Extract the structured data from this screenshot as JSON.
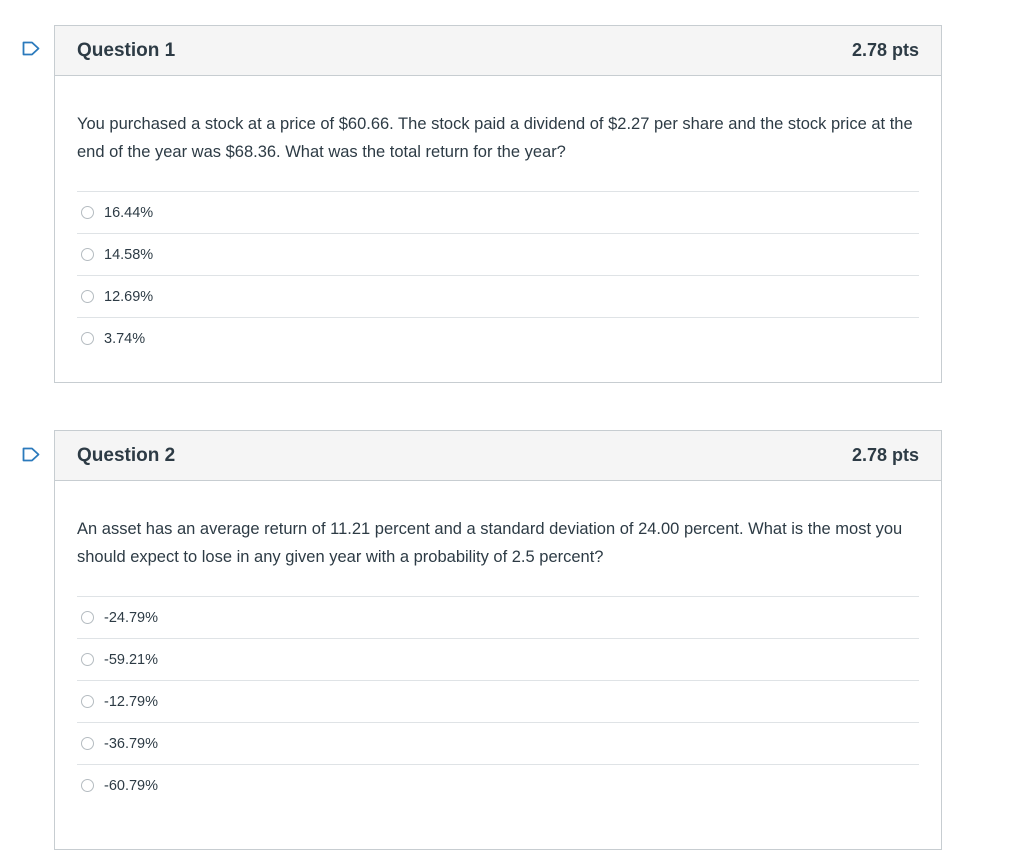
{
  "questions": [
    {
      "title": "Question 1",
      "points": "2.78 pts",
      "text": "You purchased a stock at a price of $60.66. The stock paid a dividend of $2.27 per share and the stock price at the end of the year was $68.36. What was the total return for the year?",
      "answers": [
        "16.44%",
        "14.58%",
        "12.69%",
        "3.74%"
      ]
    },
    {
      "title": "Question 2",
      "points": "2.78 pts",
      "text": "An asset has an average return of 11.21 percent and a standard deviation of 24.00 percent. What is the most you should expect to lose in any given year with a probability of 2.5 percent?",
      "answers": [
        "-24.79%",
        "-59.21%",
        "-12.79%",
        "-36.79%",
        "-60.79%"
      ]
    }
  ],
  "colors": {
    "border": "#c7cdd1",
    "header_bg": "#f5f5f5",
    "text": "#2d3b45",
    "flag": "#2b7abc"
  },
  "icons": {
    "flag": "flag-bookmark-icon",
    "radio": "radio-unchecked-icon"
  }
}
